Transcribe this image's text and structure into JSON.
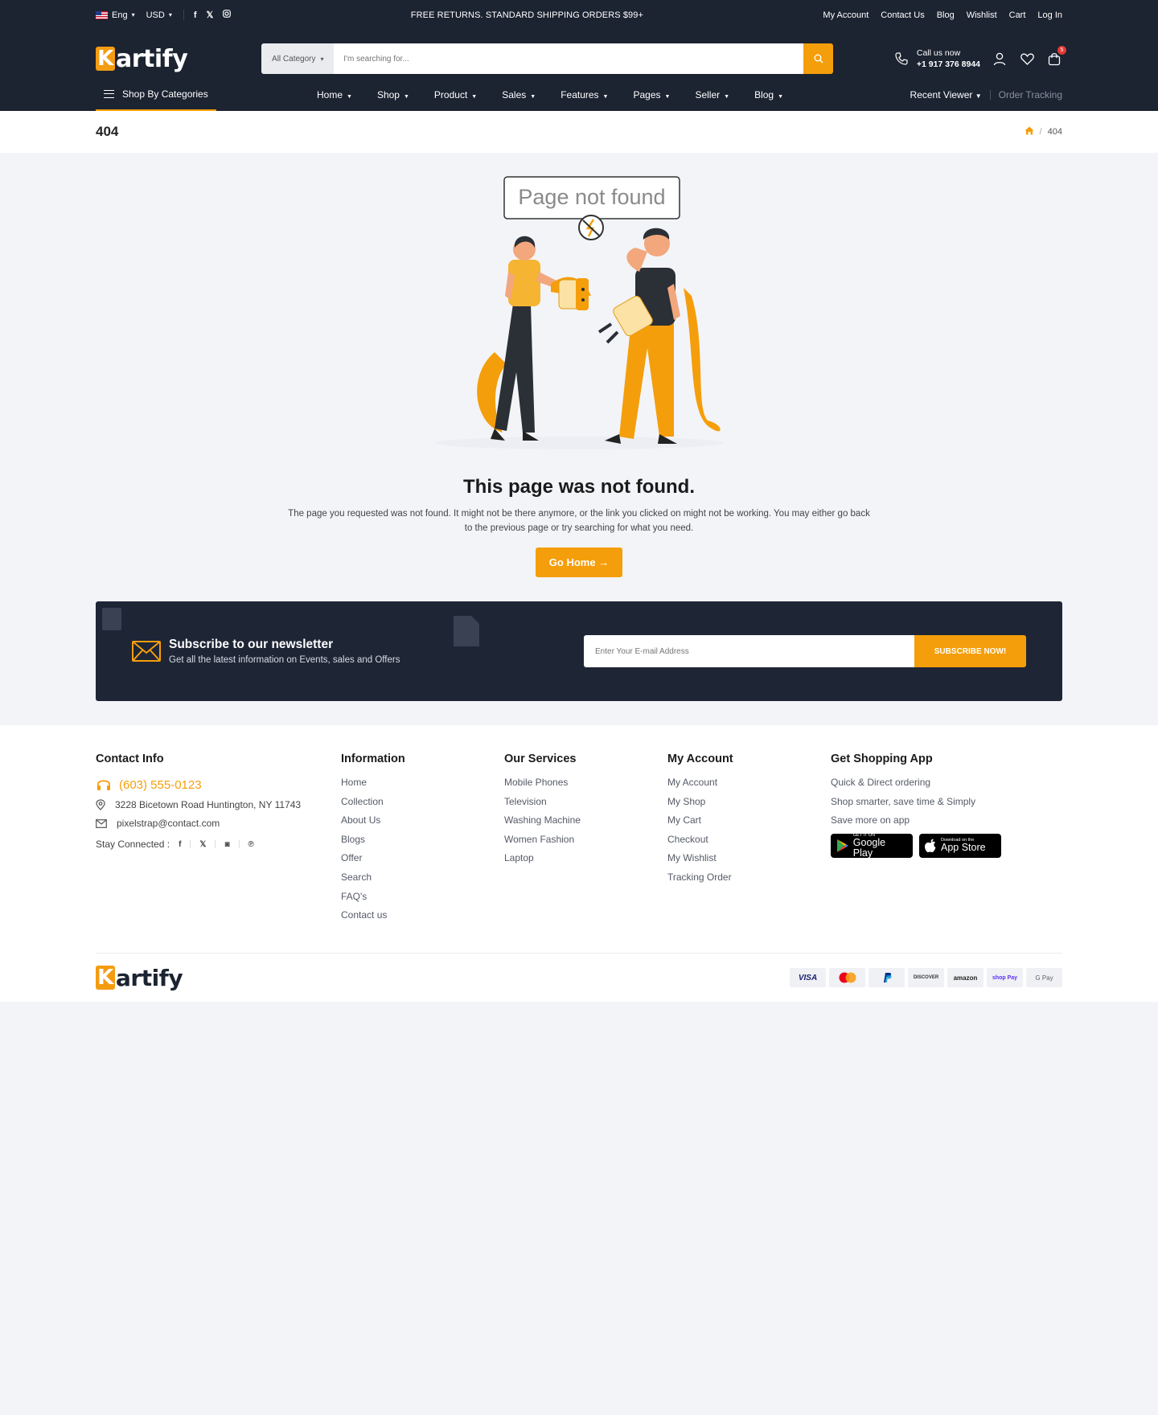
{
  "topbar": {
    "language": "Eng",
    "currency": "USD",
    "promo": "FREE RETURNS. STANDARD SHIPPING ORDERS $99+",
    "links": [
      "My Account",
      "Contact Us",
      "Blog",
      "Wishlist",
      "Cart",
      "Log In"
    ]
  },
  "header": {
    "logo_initial": "K",
    "logo_rest": "artify",
    "search_category": "All Category",
    "search_placeholder": "I'm searching for...",
    "call_label": "Call us now",
    "call_number": "+1 917 376 8944",
    "cart_count": "5",
    "shop_by_categories": "Shop By Categories",
    "nav": [
      "Home",
      "Shop",
      "Product",
      "Sales",
      "Features",
      "Pages",
      "Seller",
      "Blog"
    ],
    "recent_viewer": "Recent Viewer",
    "order_tracking": "Order Tracking"
  },
  "breadcrumb": {
    "title": "404",
    "current": "404",
    "separator": "/"
  },
  "not_found": {
    "sign_text": "Page not found",
    "heading": "This page was not found.",
    "message": "The page you requested was not found. It might not be there anymore, or the link you clicked on might not be working. You may either go back to the previous page or try searching for what you need.",
    "button": "Go Home →"
  },
  "newsletter": {
    "title": "Subscribe to our newsletter",
    "subtitle": "Get all the latest information on Events, sales and Offers",
    "placeholder": "Enter Your E-mail Address",
    "button": "SUBSCRIBE NOW!"
  },
  "footer": {
    "contact": {
      "title": "Contact Info",
      "phone": "(603) 555-0123",
      "address": "3228 Bicetown Road Huntington, NY 11743",
      "email": "pixelstrap@contact.com",
      "stay_connected": "Stay Connected :"
    },
    "information": {
      "title": "Information",
      "items": [
        "Home",
        "Collection",
        "About Us",
        "Blogs",
        "Offer",
        "Search",
        "FAQ's",
        "Contact us"
      ]
    },
    "services": {
      "title": "Our Services",
      "items": [
        "Mobile Phones",
        "Television",
        "Washing Machine",
        "Women Fashion",
        "Laptop"
      ]
    },
    "account": {
      "title": "My Account",
      "items": [
        "My Account",
        "My Shop",
        "My Cart",
        "Checkout",
        "My Wishlist",
        "Tracking Order"
      ]
    },
    "app": {
      "title": "Get Shopping App",
      "items": [
        "Quick & Direct ordering",
        "Shop smarter, save time & Simply",
        "Save more on app"
      ],
      "google_small": "GET IT ON",
      "google_big": "Google Play",
      "apple_small": "Download on the",
      "apple_big": "App Store"
    },
    "payments": [
      "VISA",
      "",
      "",
      "DISCOVER",
      "amazon",
      "shop Pay",
      "G Pay"
    ]
  },
  "colors": {
    "accent": "#f59e0b",
    "dark": "#1c2331",
    "background": "#f3f4f8"
  }
}
